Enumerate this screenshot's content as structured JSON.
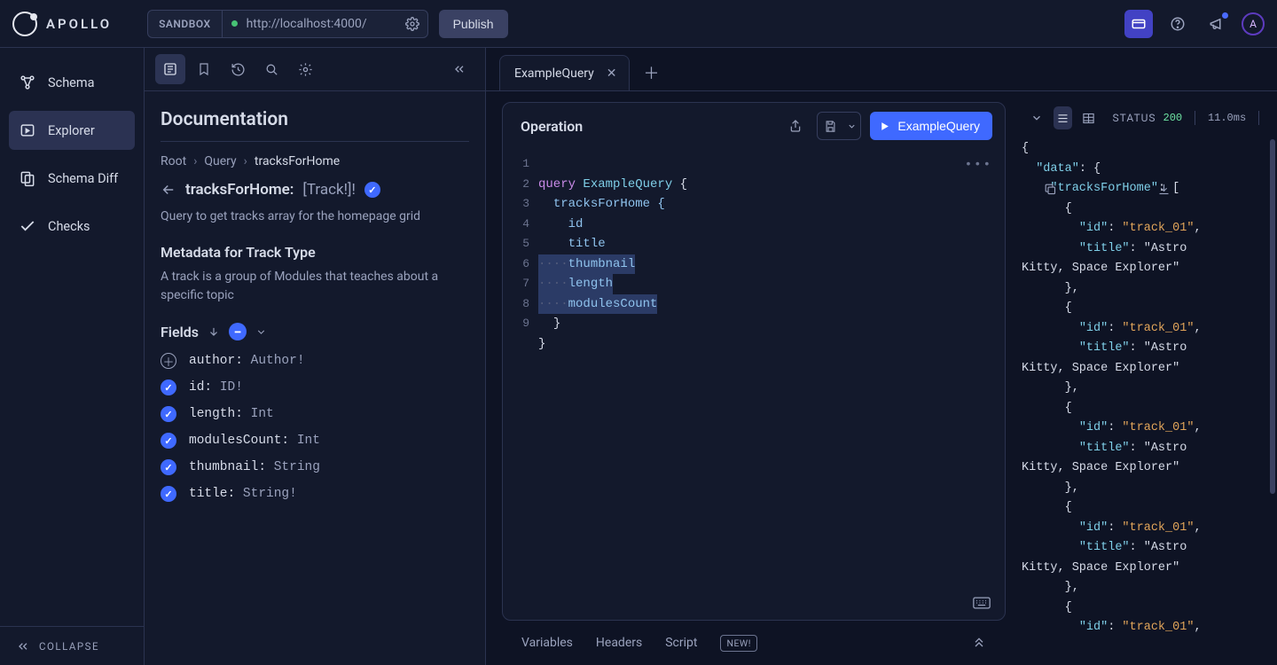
{
  "brand": "APOLLO",
  "topbar": {
    "env_label": "SANDBOX",
    "url": "http://localhost:4000/",
    "publish": "Publish"
  },
  "sidebar": {
    "items": [
      {
        "label": "Schema"
      },
      {
        "label": "Explorer"
      },
      {
        "label": "Schema Diff"
      },
      {
        "label": "Checks"
      }
    ],
    "collapse": "COLLAPSE"
  },
  "doc": {
    "title": "Documentation",
    "crumbs": [
      "Root",
      "Query",
      "tracksForHome"
    ],
    "field_name": "tracksForHome:",
    "field_type": "[Track!]!",
    "description": "Query to get tracks array for the homepage grid",
    "meta_head": "Metadata for Track Type",
    "meta_desc": "A track is a group of Modules that teaches about a specific topic",
    "fields_label": "Fields",
    "fields": [
      {
        "name": "author:",
        "type": "Author!",
        "checked": false
      },
      {
        "name": "id:",
        "type": "ID!",
        "checked": true
      },
      {
        "name": "length:",
        "type": "Int",
        "checked": true
      },
      {
        "name": "modulesCount:",
        "type": "Int",
        "checked": true
      },
      {
        "name": "thumbnail:",
        "type": "String",
        "checked": true
      },
      {
        "name": "title:",
        "type": "String!",
        "checked": true
      }
    ]
  },
  "tabs": {
    "active": "ExampleQuery"
  },
  "operation": {
    "title": "Operation",
    "run_label": "ExampleQuery",
    "gutter": [
      "1",
      "2",
      "3",
      "4",
      "5",
      "6",
      "7",
      "8",
      "9"
    ],
    "code": {
      "l1_kw": "query",
      "l1_nm": "ExampleQuery",
      "l1_b": "{",
      "l2": "tracksForHome {",
      "l3": "id",
      "l4": "title",
      "l5": "thumbnail",
      "l6": "length",
      "l7": "modulesCount",
      "l8": "}",
      "l9": "}"
    }
  },
  "bottom": {
    "variables": "Variables",
    "headers": "Headers",
    "script": "Script",
    "new": "NEW!"
  },
  "response": {
    "status_label": "STATUS",
    "status_code": "200",
    "time": "11.0ms",
    "json_text": "{\n  \"data\": {\n    \"tracksForHome\": [\n      {\n        \"id\": \"track_01\",\n        \"title\": \"Astro\nKitty, Space Explorer\"\n      },\n      {\n        \"id\": \"track_01\",\n        \"title\": \"Astro\nKitty, Space Explorer\"\n      },\n      {\n        \"id\": \"track_01\",\n        \"title\": \"Astro\nKitty, Space Explorer\"\n      },\n      {\n        \"id\": \"track_01\",\n        \"title\": \"Astro\nKitty, Space Explorer\"\n      },\n      {\n        \"id\": \"track_01\","
  }
}
